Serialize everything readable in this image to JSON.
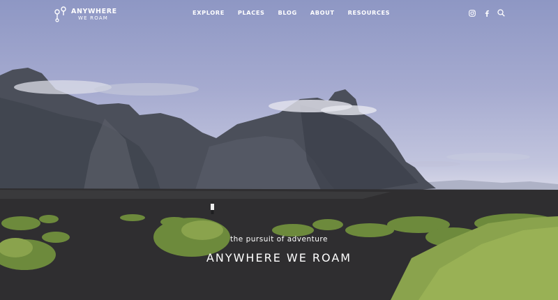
{
  "brand": {
    "line1": "ANYWHERE",
    "line2": "WE ROAM"
  },
  "nav": {
    "items": [
      {
        "label": "EXPLORE"
      },
      {
        "label": "PLACES"
      },
      {
        "label": "BLOG"
      },
      {
        "label": "ABOUT"
      },
      {
        "label": "RESOURCES"
      }
    ]
  },
  "icons": [
    "instagram-icon",
    "facebook-icon",
    "search-icon"
  ],
  "hero": {
    "tagline": "the pursuit of adventure",
    "title": "ANYWHERE WE ROAM"
  },
  "colors": {
    "sky": "#a6abd0",
    "mountain": "#4a4e58",
    "sand": "#2e2d2e",
    "grass": "#7d9845",
    "text": "#ffffff"
  }
}
